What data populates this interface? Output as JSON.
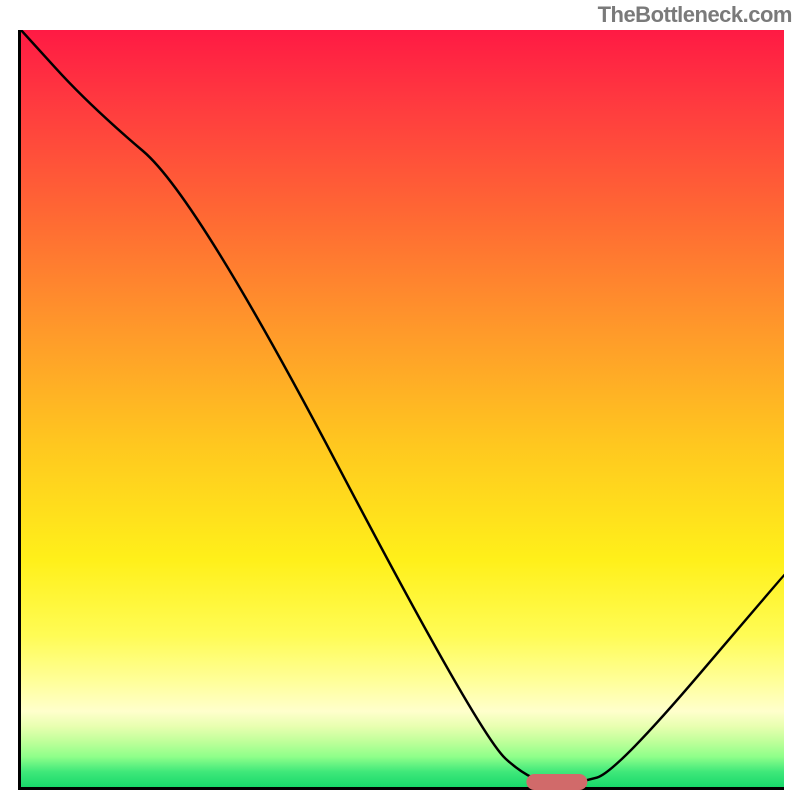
{
  "watermark": "TheBottleneck.com",
  "chart_data": {
    "type": "line",
    "title": "",
    "xlabel": "",
    "ylabel": "",
    "xlim": [
      0,
      100
    ],
    "ylim": [
      0,
      100
    ],
    "x": [
      0,
      9,
      23,
      60,
      67,
      73,
      78,
      100
    ],
    "values": [
      100,
      90,
      78,
      7,
      0.5,
      0.5,
      2,
      28
    ],
    "marker": {
      "x_center": 70,
      "width_pct": 8
    },
    "background": {
      "type": "vertical-gradient",
      "stops": [
        {
          "pct": 0,
          "color": "#ff1a44"
        },
        {
          "pct": 55,
          "color": "#ffc81f"
        },
        {
          "pct": 86,
          "color": "#ffff99"
        },
        {
          "pct": 100,
          "color": "#18d86a"
        }
      ],
      "semantics": "red (high bottleneck) → green (no bottleneck)"
    }
  }
}
